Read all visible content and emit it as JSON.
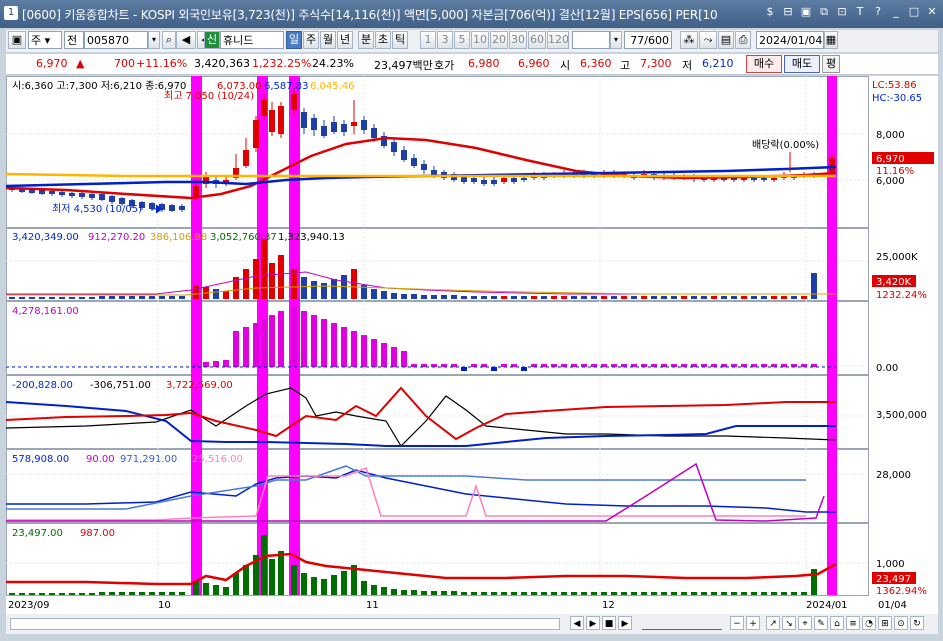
{
  "window": {
    "number": "1",
    "title": "[0600] 키움종합차트 - KOSPI 외국인보유[3,723(천)] 주식수[14,116(천)] 액면[5,000] 자본금[706(억)] 결산[12월] EPS[656] PER[10",
    "icons": [
      "dollar-icon",
      "ruler-icon",
      "ticker-icon",
      "new-window-icon",
      "link-icon",
      "font-icon",
      "help-icon",
      "minimize-icon",
      "maximize-icon",
      "close-icon"
    ]
  },
  "toolbar": {
    "type_label": "주",
    "jeon_label": "전",
    "code": "005870",
    "sin_label": "신",
    "stock_name": "휴니드",
    "periods": [
      "일",
      "주",
      "월",
      "년",
      "분",
      "초",
      "틱"
    ],
    "active_period": "일",
    "intervals": [
      "1",
      "3",
      "5",
      "10",
      "20",
      "30",
      "60",
      "120"
    ],
    "count": "77/600",
    "date": "2024/01/04"
  },
  "info": {
    "price": "6,970",
    "up_arrow": "▲",
    "change": "700",
    "change_pct": "+11.16%",
    "volume": "3,420,363",
    "vol_ratio": "1,232.25%",
    "turnover": "24.23%",
    "amount": "23,497백만",
    "quote_label": "호가",
    "ask": "6,980",
    "bid": "6,960",
    "open_label": "시",
    "open": "6,360",
    "high_label": "고",
    "high": "7,300",
    "low_label": "저",
    "low": "6,210",
    "buy_btn": "매수",
    "sell_btn": "매도",
    "eval_btn": "평"
  },
  "price_panel": {
    "header_ohlc": "시:6,360 고:7,300 저:6,210 종:6,970",
    "ma_values": [
      "6,073.00",
      "6,587.83",
      "6,045.46"
    ],
    "ma_colors": [
      "#d40000",
      "#0028d0",
      "#ffb400"
    ],
    "high_label": "최고 7,050 (10/24)",
    "low_label": "최저 4,530 (10/05)",
    "dividend_label": "배당락(0.00%)",
    "lc": "LC:53.86",
    "hc": "HC:-30.65",
    "axis_8000": "8,000",
    "axis_6000": "6,000",
    "last_price_tag": "6,970",
    "last_pct": "11.16%"
  },
  "volume_panel": {
    "values": [
      "3,420,349.00",
      "912,270.20",
      "386,106.88",
      "3,052,760.37",
      "1,323,940.13"
    ],
    "colors": [
      "#0028d0",
      "#c000c0",
      "#d4a000",
      "#007000",
      "#000000"
    ],
    "axis_25000k": "25,000K",
    "tag_value": "3,420K",
    "tag_pct": "1232.24%"
  },
  "foreign_panel": {
    "value": "4,278,161.00",
    "axis_zero": "0.00"
  },
  "investor_panel": {
    "values": [
      "-200,828.00",
      "-306,751.00",
      "3,722,569.00"
    ],
    "colors": [
      "#0028d0",
      "#000000",
      "#e00000"
    ],
    "axis": "3,500,000"
  },
  "obv_panel": {
    "values": [
      "578,908.00",
      "90.00",
      "971,291.00",
      "25,516.00"
    ],
    "colors": [
      "#0028d0",
      "#c000c0",
      "#3060d0",
      "#ff80c0"
    ],
    "axis": "28,000"
  },
  "amount_panel": {
    "values": [
      "23,497.00",
      "987.00"
    ],
    "colors": [
      "#007000",
      "#e00000"
    ],
    "axis_1000": "1,000",
    "tag_value": "23,497",
    "tag_pct": "1362.94%"
  },
  "date_axis": {
    "labels": [
      "2023/09",
      "10",
      "11",
      "12",
      "2024/01"
    ],
    "right_label": "01/04"
  },
  "chart_data": {
    "type": "candlestick",
    "x": [
      "2023-09",
      "2023-10",
      "2023-11",
      "2023-12",
      "2024-01"
    ],
    "highlighted_days": [
      "2023-10-11",
      "2023-10-20",
      "2023-10-25",
      "2024-01-04"
    ],
    "last_close": 6970,
    "highest": 7050,
    "lowest": 4530
  }
}
